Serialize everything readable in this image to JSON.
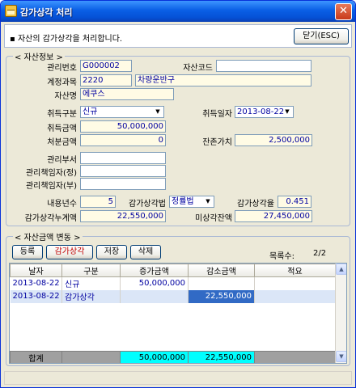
{
  "window": {
    "title": "감가상각 처리"
  },
  "header": {
    "message": "▪ 자산의 감가상각을 처리합니다.",
    "close_label": "닫기(ESC)"
  },
  "asset_info": {
    "legend": "< 자산정보 >",
    "mgmt_no_label": "관리번호",
    "mgmt_no": "G000002",
    "asset_code_label": "자산코드",
    "asset_code": "",
    "account_label": "계정과목",
    "account_code": "2220",
    "account_name": "차량운반구",
    "asset_name_label": "자산명",
    "asset_name": "에쿠스",
    "acq_type_label": "취득구분",
    "acq_type": "신규",
    "acq_date_label": "취득일자",
    "acq_date": "2013-08-22",
    "acq_amount_label": "취득금액",
    "acq_amount": "50,000,000",
    "disposal_label": "처분금액",
    "disposal_amount": "0",
    "residual_label": "잔존가치",
    "residual_value": "2,500,000",
    "dept_label": "관리부서",
    "dept": "",
    "mgr_main_label": "관리책임자(정)",
    "mgr_main": "",
    "mgr_sub_label": "관리책임자(부)",
    "mgr_sub": "",
    "life_label": "내용년수",
    "life": "5",
    "method_label": "감가상각법",
    "method": "정률법",
    "rate_label": "감가상각율",
    "rate": "0.451",
    "accum_label": "감가상각누계액",
    "accum": "22,550,000",
    "undep_label": "미상각잔액",
    "undep": "27,450,000"
  },
  "changes": {
    "legend": "< 자산금액 변동 >",
    "buttons": {
      "register": "등록",
      "depreciate": "감가상각",
      "save": "저장",
      "delete": "삭제"
    },
    "count_label": "목록수:",
    "count": "2/2",
    "columns": [
      "날자",
      "구분",
      "증가금액",
      "감소금액",
      "적요"
    ],
    "rows": [
      {
        "date": "2013-08-22",
        "type": "신규",
        "increase": "50,000,000",
        "decrease": "",
        "memo": ""
      },
      {
        "date": "2013-08-22",
        "type": "감가상각",
        "increase": "",
        "decrease": "22,550,000",
        "memo": ""
      }
    ],
    "total": {
      "label": "합계",
      "increase": "50,000,000",
      "decrease": "22,550,000"
    }
  },
  "colors": {
    "title_bar": "#0a5fe5",
    "total_highlight": "#00ffff",
    "selected_cell": "#316ac5",
    "selected_row": "#dbe6f7"
  }
}
